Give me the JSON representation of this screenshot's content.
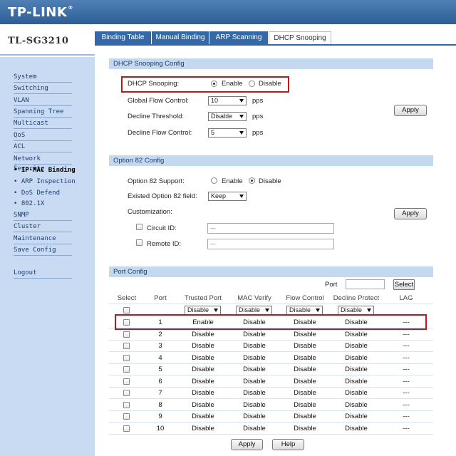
{
  "brand": {
    "logo": "TP-LINK",
    "reg": "®",
    "model": "TL-SG3210"
  },
  "tabs": [
    {
      "label": "Binding Table"
    },
    {
      "label": "Manual Binding"
    },
    {
      "label": "ARP Scanning"
    },
    {
      "label": "DHCP Snooping"
    }
  ],
  "sidebar": {
    "items": [
      {
        "label": "System"
      },
      {
        "label": "Switching"
      },
      {
        "label": "VLAN"
      },
      {
        "label": "Spanning Tree"
      },
      {
        "label": "Multicast"
      },
      {
        "label": "QoS"
      },
      {
        "label": "ACL"
      },
      {
        "label": "Network Security"
      },
      {
        "label": "• IP-MAC Binding"
      },
      {
        "label": "• ARP Inspection"
      },
      {
        "label": "• DoS Defend"
      },
      {
        "label": "• 802.1X"
      },
      {
        "label": "SNMP"
      },
      {
        "label": "Cluster"
      },
      {
        "label": "Maintenance"
      },
      {
        "label": "Save Config"
      },
      {
        "label": "Logout"
      }
    ]
  },
  "dhcp": {
    "title": "DHCP Snooping Config",
    "snooping_label": "DHCP Snooping:",
    "enable": "Enable",
    "disable": "Disable",
    "gfc_label": "Global Flow Control:",
    "gfc_value": "10",
    "pps": "pps",
    "dt_label": "Decline Threshold:",
    "dt_value": "Disable",
    "dfc_label": "Decline Flow Control:",
    "dfc_value": "5",
    "apply": "Apply"
  },
  "opt82": {
    "title": "Option 82 Config",
    "support_label": "Option 82 Support:",
    "enable": "Enable",
    "disable": "Disable",
    "existed_label": "Existed Option 82 field:",
    "existed_value": "Keep",
    "custom_label": "Customization:",
    "circuit_label": "Circuit ID:",
    "circuit_value": "---",
    "remote_label": "Remote ID:",
    "remote_value": "---",
    "apply": "Apply"
  },
  "ports": {
    "title": "Port Config",
    "port_label": "Port",
    "select_btn": "Select",
    "headers": [
      "Select",
      "Port",
      "Trusted Port",
      "MAC Verify",
      "Flow Control",
      "Decline Protect",
      "LAG"
    ],
    "bulk": [
      "Disable",
      "Disable",
      "Disable",
      "Disable"
    ],
    "rows": [
      {
        "port": "1",
        "trusted": "Enable",
        "mac": "Disable",
        "flow": "Disable",
        "decline": "Disable",
        "lag": "---"
      },
      {
        "port": "2",
        "trusted": "Disable",
        "mac": "Disable",
        "flow": "Disable",
        "decline": "Disable",
        "lag": "---"
      },
      {
        "port": "3",
        "trusted": "Disable",
        "mac": "Disable",
        "flow": "Disable",
        "decline": "Disable",
        "lag": "---"
      },
      {
        "port": "4",
        "trusted": "Disable",
        "mac": "Disable",
        "flow": "Disable",
        "decline": "Disable",
        "lag": "---"
      },
      {
        "port": "5",
        "trusted": "Disable",
        "mac": "Disable",
        "flow": "Disable",
        "decline": "Disable",
        "lag": "---"
      },
      {
        "port": "6",
        "trusted": "Disable",
        "mac": "Disable",
        "flow": "Disable",
        "decline": "Disable",
        "lag": "---"
      },
      {
        "port": "7",
        "trusted": "Disable",
        "mac": "Disable",
        "flow": "Disable",
        "decline": "Disable",
        "lag": "---"
      },
      {
        "port": "8",
        "trusted": "Disable",
        "mac": "Disable",
        "flow": "Disable",
        "decline": "Disable",
        "lag": "---"
      },
      {
        "port": "9",
        "trusted": "Disable",
        "mac": "Disable",
        "flow": "Disable",
        "decline": "Disable",
        "lag": "---"
      },
      {
        "port": "10",
        "trusted": "Disable",
        "mac": "Disable",
        "flow": "Disable",
        "decline": "Disable",
        "lag": "---"
      }
    ],
    "apply": "Apply",
    "help": "Help"
  }
}
